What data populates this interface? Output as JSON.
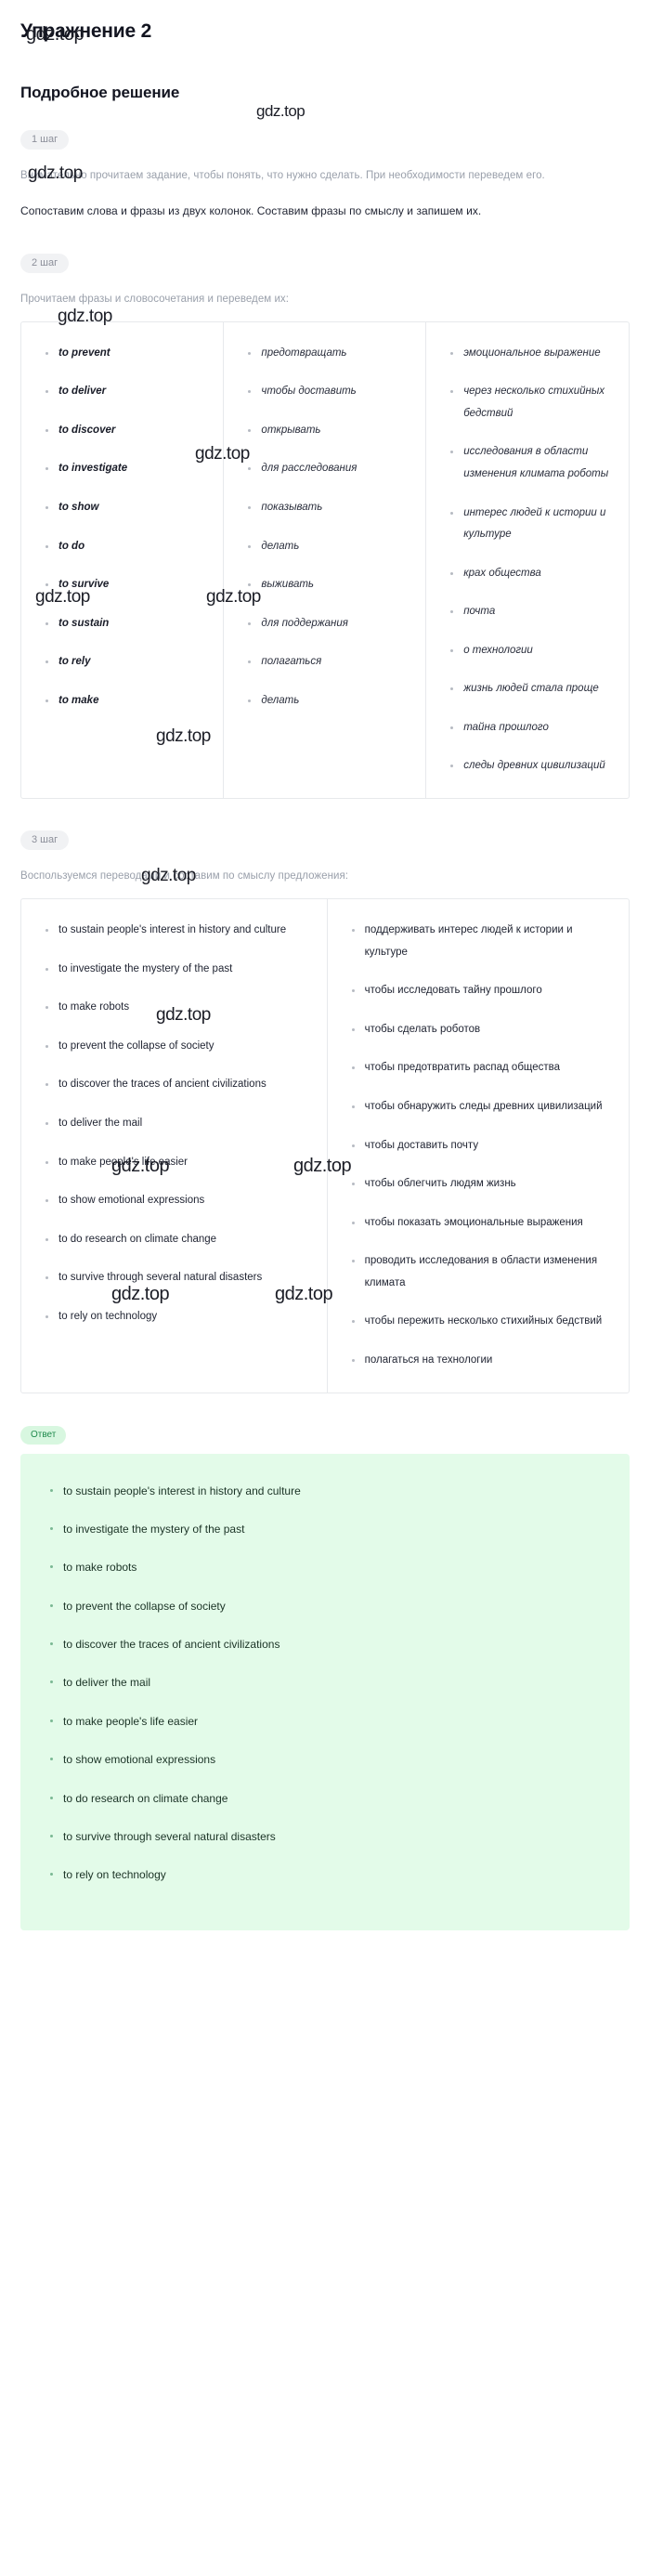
{
  "header": {
    "exercise_title": "Упражнение 2",
    "solution_title": "Подробное решение"
  },
  "watermark": {
    "text": "gdz.top"
  },
  "steps": [
    {
      "badge": "1 шаг",
      "paragraphs": [
        "Внимательно прочитаем задание, чтобы понять, что нужно сделать. При необходимости переведем его.",
        "Сопоставим слова и фразы из двух колонок. Составим фразы по смыслу и запишем их."
      ]
    },
    {
      "badge": "2 шаг",
      "intro": "Прочитаем фразы и словосочетания и переведем их:",
      "columns": [
        {
          "name": "english-phrases",
          "items": [
            "to prevent",
            "to deliver",
            "to discover",
            "to investigate",
            "to show",
            "to do",
            "to survive",
            "to sustain",
            "to rely",
            "to make"
          ]
        },
        {
          "name": "russian-verbs",
          "items": [
            "предотвращать",
            "чтобы доставить",
            "открывать",
            "для расследования",
            "показывать",
            "делать",
            "выживать",
            "для поддержания",
            "полагаться",
            "делать"
          ]
        },
        {
          "name": "russian-objects",
          "items": [
            "эмоциональное выражение",
            "через несколько стихийных бедствий",
            "исследования в области изменения климата роботы",
            "интерес людей к истории и культуре",
            "крах общества",
            "почта",
            "о технологии",
            "жизнь людей стала проще",
            "тайна прошлого",
            "следы древних цивилизаций"
          ]
        }
      ]
    },
    {
      "badge": "3 шаг",
      "intro": "Воспользуемся переводами и составим по смыслу предложения:",
      "columns": [
        {
          "name": "english-sentences",
          "items": [
            "to sustain people's interest in history and culture",
            "to investigate the mystery of the past",
            "to make robots",
            "to prevent the collapse of society",
            "to discover the traces of ancient civilizations",
            "to deliver the mail",
            "to make people's life easier",
            "to show emotional expressions",
            "to do research on climate change",
            "to survive through several natural disasters",
            "to rely on technology"
          ]
        },
        {
          "name": "russian-sentences",
          "items": [
            "поддерживать интерес людей к истории и культуре",
            "чтобы исследовать тайну прошлого",
            "чтобы сделать роботов",
            "чтобы предотвратить распад общества",
            "чтобы обнаружить следы древних цивилизаций",
            "чтобы доставить почту",
            "чтобы облегчить людям жизнь",
            "чтобы показать эмоциональные выражения",
            "проводить исследования в области изменения климата",
            "чтобы пережить несколько стихийных бедствий",
            "полагаться на технологии"
          ]
        }
      ]
    }
  ],
  "answer": {
    "badge": "Ответ",
    "items": [
      "to sustain people's interest in history and culture",
      "to investigate the mystery of the past",
      "to make robots",
      "to prevent the collapse of society",
      "to discover the traces of ancient civilizations",
      "to deliver the mail",
      "to make people's life easier",
      "to show emotional expressions",
      "to do research on climate change",
      "to survive through several natural disasters",
      "to rely on technology"
    ]
  },
  "colors": {
    "answer_bg": "#e3fbe9",
    "answer_badge_bg": "#d8f7e0",
    "answer_badge_text": "#1f8a4c",
    "step_badge_bg": "#f1f2f4",
    "muted_text": "#9aa0ab",
    "border": "#e7e9ec"
  }
}
